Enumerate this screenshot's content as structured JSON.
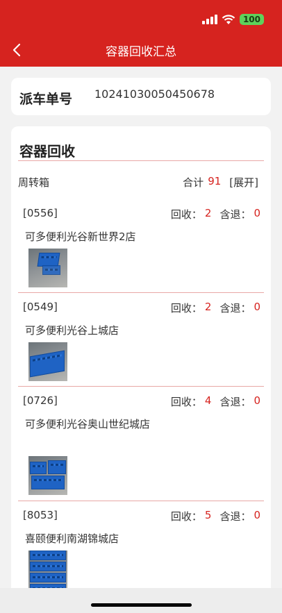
{
  "status": {
    "time": "",
    "battery": "100"
  },
  "header": {
    "title": "容器回收汇总"
  },
  "dispatch": {
    "label": "派车单号",
    "value": "10241030050450678"
  },
  "recycle": {
    "title": "容器回收",
    "container_type": "周转箱",
    "total_label": "合计",
    "total": "91",
    "expand_label": "[展开]",
    "recycle_label": "回收：",
    "return_label": "含退：",
    "items": [
      {
        "code": "[0556]",
        "name": "可多便利光谷新世界2店",
        "recycled": "2",
        "returned": "0"
      },
      {
        "code": "[0549]",
        "name": "可多便利光谷上城店",
        "recycled": "2",
        "returned": "0"
      },
      {
        "code": "[0726]",
        "name": "可多便利光谷奥山世纪城店",
        "recycled": "4",
        "returned": "0"
      },
      {
        "code": "[8053]",
        "name": "喜颐便利南湖锦城店",
        "recycled": "5",
        "returned": "0"
      }
    ]
  }
}
